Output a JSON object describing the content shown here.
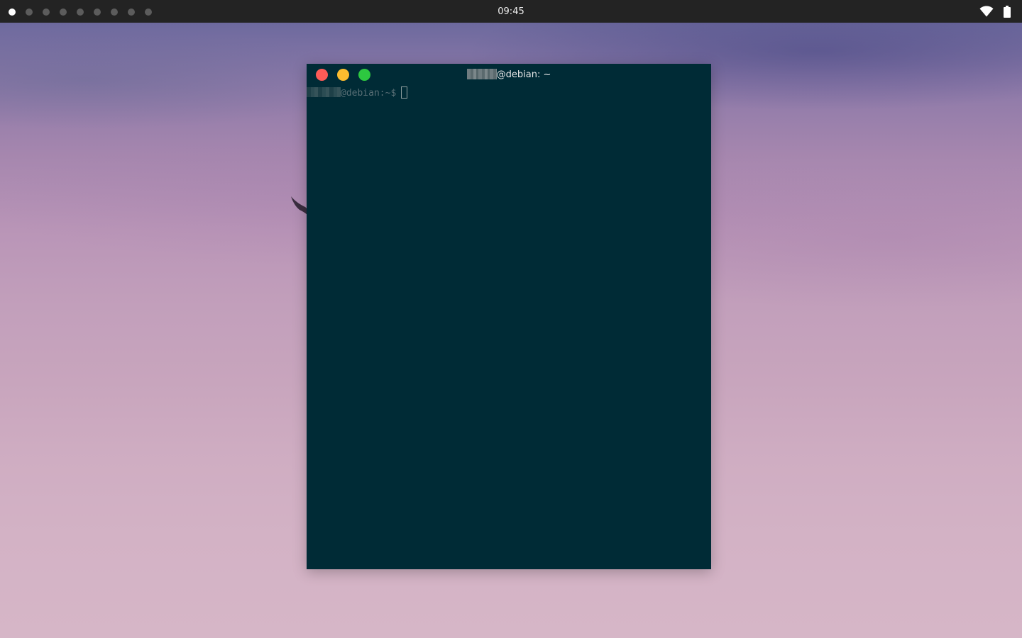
{
  "desktop": {
    "wallpaper": "pink-purple sky with bird silhouette",
    "bird_icon": "bird-silhouette"
  },
  "topbar": {
    "clock": "09:45",
    "workspaces": [
      {
        "active": true
      },
      {
        "active": false
      },
      {
        "active": false
      },
      {
        "active": false
      },
      {
        "active": false
      },
      {
        "active": false
      },
      {
        "active": false
      },
      {
        "active": false
      },
      {
        "active": false
      }
    ],
    "tray_icons": [
      "wifi-icon",
      "battery-icon"
    ]
  },
  "terminal": {
    "title_suffix": "@debian: ~",
    "prompt_suffix": "@debian:~$",
    "colors": {
      "background": "#002b36",
      "prompt": "#586e75",
      "close": "#fc5b57",
      "minimize": "#fcbc2f",
      "maximize": "#2dc840"
    }
  }
}
